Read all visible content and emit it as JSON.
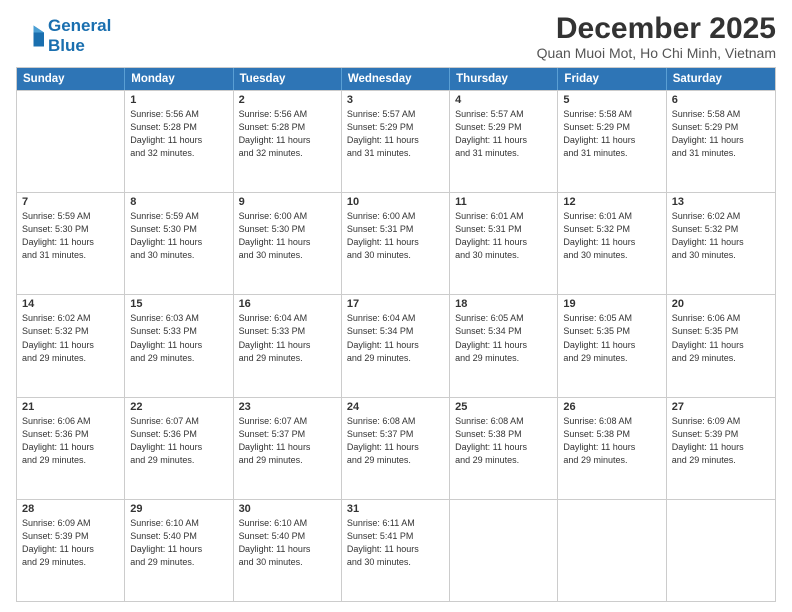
{
  "logo": {
    "line1": "General",
    "line2": "Blue"
  },
  "title": "December 2025",
  "subtitle": "Quan Muoi Mot, Ho Chi Minh, Vietnam",
  "headers": [
    "Sunday",
    "Monday",
    "Tuesday",
    "Wednesday",
    "Thursday",
    "Friday",
    "Saturday"
  ],
  "weeks": [
    [
      {
        "day": "",
        "info": ""
      },
      {
        "day": "1",
        "info": "Sunrise: 5:56 AM\nSunset: 5:28 PM\nDaylight: 11 hours\nand 32 minutes."
      },
      {
        "day": "2",
        "info": "Sunrise: 5:56 AM\nSunset: 5:28 PM\nDaylight: 11 hours\nand 32 minutes."
      },
      {
        "day": "3",
        "info": "Sunrise: 5:57 AM\nSunset: 5:29 PM\nDaylight: 11 hours\nand 31 minutes."
      },
      {
        "day": "4",
        "info": "Sunrise: 5:57 AM\nSunset: 5:29 PM\nDaylight: 11 hours\nand 31 minutes."
      },
      {
        "day": "5",
        "info": "Sunrise: 5:58 AM\nSunset: 5:29 PM\nDaylight: 11 hours\nand 31 minutes."
      },
      {
        "day": "6",
        "info": "Sunrise: 5:58 AM\nSunset: 5:29 PM\nDaylight: 11 hours\nand 31 minutes."
      }
    ],
    [
      {
        "day": "7",
        "info": "Sunrise: 5:59 AM\nSunset: 5:30 PM\nDaylight: 11 hours\nand 31 minutes."
      },
      {
        "day": "8",
        "info": "Sunrise: 5:59 AM\nSunset: 5:30 PM\nDaylight: 11 hours\nand 30 minutes."
      },
      {
        "day": "9",
        "info": "Sunrise: 6:00 AM\nSunset: 5:30 PM\nDaylight: 11 hours\nand 30 minutes."
      },
      {
        "day": "10",
        "info": "Sunrise: 6:00 AM\nSunset: 5:31 PM\nDaylight: 11 hours\nand 30 minutes."
      },
      {
        "day": "11",
        "info": "Sunrise: 6:01 AM\nSunset: 5:31 PM\nDaylight: 11 hours\nand 30 minutes."
      },
      {
        "day": "12",
        "info": "Sunrise: 6:01 AM\nSunset: 5:32 PM\nDaylight: 11 hours\nand 30 minutes."
      },
      {
        "day": "13",
        "info": "Sunrise: 6:02 AM\nSunset: 5:32 PM\nDaylight: 11 hours\nand 30 minutes."
      }
    ],
    [
      {
        "day": "14",
        "info": "Sunrise: 6:02 AM\nSunset: 5:32 PM\nDaylight: 11 hours\nand 29 minutes."
      },
      {
        "day": "15",
        "info": "Sunrise: 6:03 AM\nSunset: 5:33 PM\nDaylight: 11 hours\nand 29 minutes."
      },
      {
        "day": "16",
        "info": "Sunrise: 6:04 AM\nSunset: 5:33 PM\nDaylight: 11 hours\nand 29 minutes."
      },
      {
        "day": "17",
        "info": "Sunrise: 6:04 AM\nSunset: 5:34 PM\nDaylight: 11 hours\nand 29 minutes."
      },
      {
        "day": "18",
        "info": "Sunrise: 6:05 AM\nSunset: 5:34 PM\nDaylight: 11 hours\nand 29 minutes."
      },
      {
        "day": "19",
        "info": "Sunrise: 6:05 AM\nSunset: 5:35 PM\nDaylight: 11 hours\nand 29 minutes."
      },
      {
        "day": "20",
        "info": "Sunrise: 6:06 AM\nSunset: 5:35 PM\nDaylight: 11 hours\nand 29 minutes."
      }
    ],
    [
      {
        "day": "21",
        "info": "Sunrise: 6:06 AM\nSunset: 5:36 PM\nDaylight: 11 hours\nand 29 minutes."
      },
      {
        "day": "22",
        "info": "Sunrise: 6:07 AM\nSunset: 5:36 PM\nDaylight: 11 hours\nand 29 minutes."
      },
      {
        "day": "23",
        "info": "Sunrise: 6:07 AM\nSunset: 5:37 PM\nDaylight: 11 hours\nand 29 minutes."
      },
      {
        "day": "24",
        "info": "Sunrise: 6:08 AM\nSunset: 5:37 PM\nDaylight: 11 hours\nand 29 minutes."
      },
      {
        "day": "25",
        "info": "Sunrise: 6:08 AM\nSunset: 5:38 PM\nDaylight: 11 hours\nand 29 minutes."
      },
      {
        "day": "26",
        "info": "Sunrise: 6:08 AM\nSunset: 5:38 PM\nDaylight: 11 hours\nand 29 minutes."
      },
      {
        "day": "27",
        "info": "Sunrise: 6:09 AM\nSunset: 5:39 PM\nDaylight: 11 hours\nand 29 minutes."
      }
    ],
    [
      {
        "day": "28",
        "info": "Sunrise: 6:09 AM\nSunset: 5:39 PM\nDaylight: 11 hours\nand 29 minutes."
      },
      {
        "day": "29",
        "info": "Sunrise: 6:10 AM\nSunset: 5:40 PM\nDaylight: 11 hours\nand 29 minutes."
      },
      {
        "day": "30",
        "info": "Sunrise: 6:10 AM\nSunset: 5:40 PM\nDaylight: 11 hours\nand 30 minutes."
      },
      {
        "day": "31",
        "info": "Sunrise: 6:11 AM\nSunset: 5:41 PM\nDaylight: 11 hours\nand 30 minutes."
      },
      {
        "day": "",
        "info": ""
      },
      {
        "day": "",
        "info": ""
      },
      {
        "day": "",
        "info": ""
      }
    ]
  ]
}
